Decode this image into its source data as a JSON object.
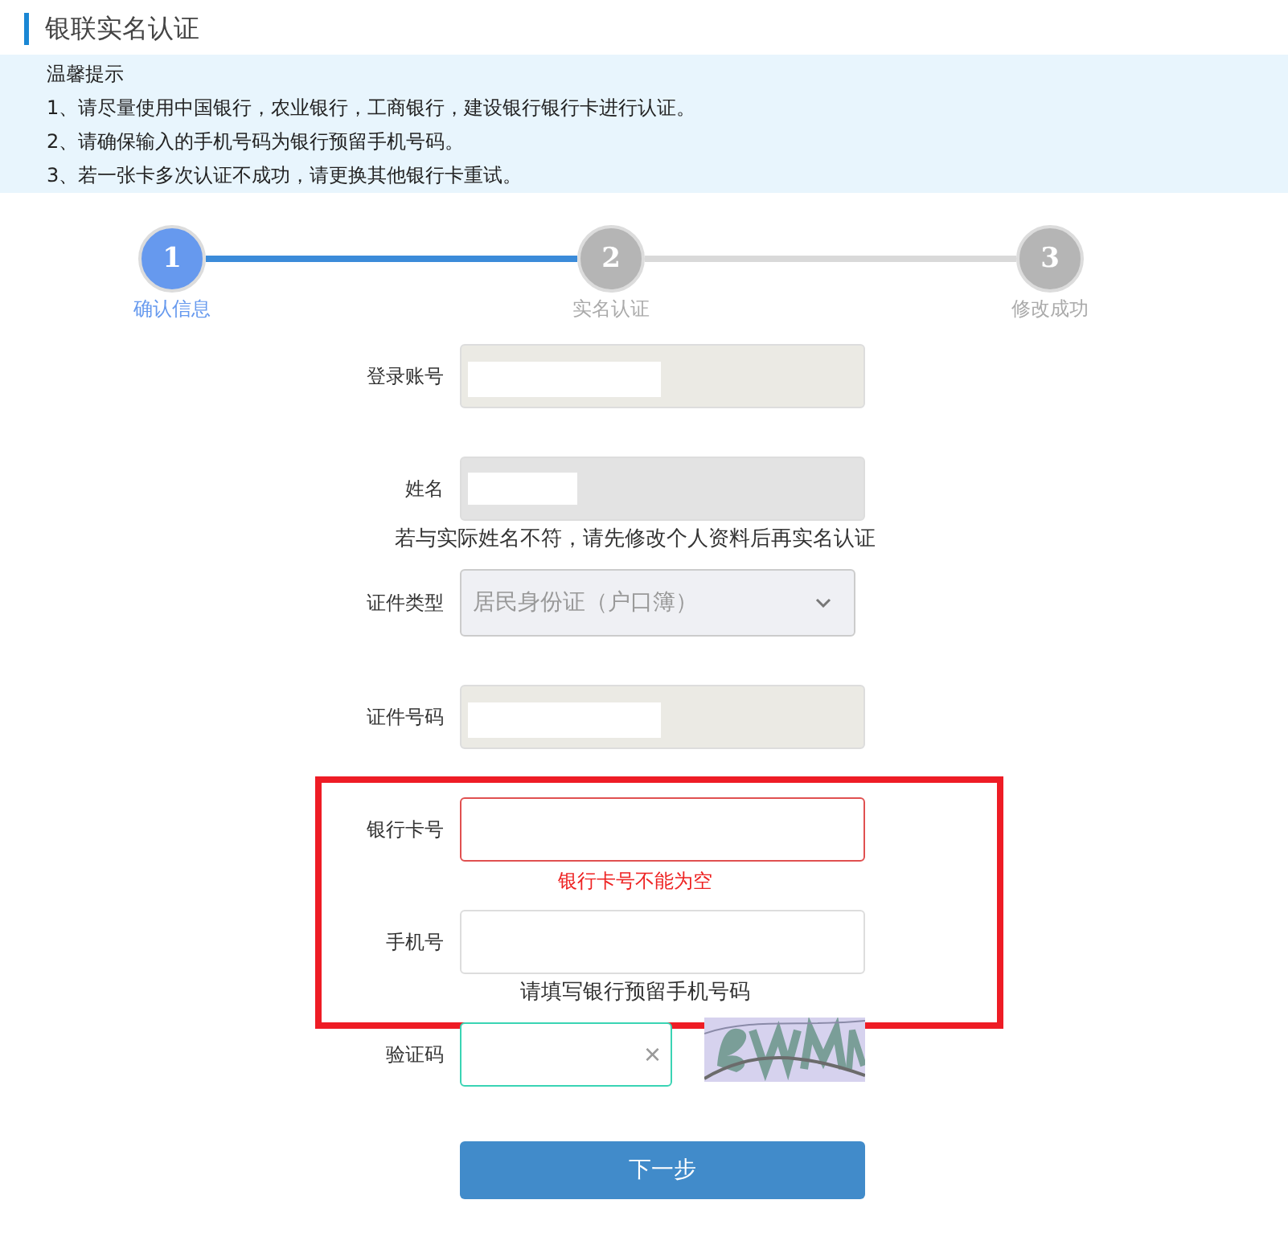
{
  "page": {
    "title": "银联实名认证"
  },
  "notice": {
    "heading": "温馨提示",
    "lines": [
      "1、请尽量使用中国银行，农业银行，工商银行，建设银行银行卡进行认证。",
      "2、请确保输入的手机号码为银行预留手机号码。",
      "3、若一张卡多次认证不成功，请更换其他银行卡重试。"
    ]
  },
  "steps": [
    {
      "number": "1",
      "label": "确认信息",
      "selected": true
    },
    {
      "number": "2",
      "label": "实名认证",
      "selected": false
    },
    {
      "number": "3",
      "label": "修改成功",
      "selected": false
    }
  ],
  "form": {
    "groups": [
      {
        "highlighted": false,
        "fields": [
          {
            "kind": "readonly",
            "label": "登录账号",
            "redacted": true
          },
          {
            "kind": "readonly_dark",
            "label": "姓名",
            "redacted": true,
            "hint": "若与实际姓名不符，请先修改个人资料后再实名认证"
          },
          {
            "kind": "select",
            "label": "证件类型",
            "value": "居民身份证（户口簿）"
          },
          {
            "kind": "readonly",
            "label": "证件号码",
            "redacted": true
          }
        ]
      },
      {
        "highlighted": true,
        "fields": [
          {
            "kind": "input",
            "label": "银行卡号",
            "error": "银行卡号不能为空"
          },
          {
            "kind": "input",
            "label": "手机号",
            "hint": "请填写银行预留手机号码"
          }
        ]
      },
      {
        "highlighted": false,
        "fields": [
          {
            "kind": "captcha",
            "label": "验证码",
            "focused": true,
            "clear": "×"
          }
        ]
      }
    ]
  },
  "submit": {
    "label": "下一步"
  }
}
